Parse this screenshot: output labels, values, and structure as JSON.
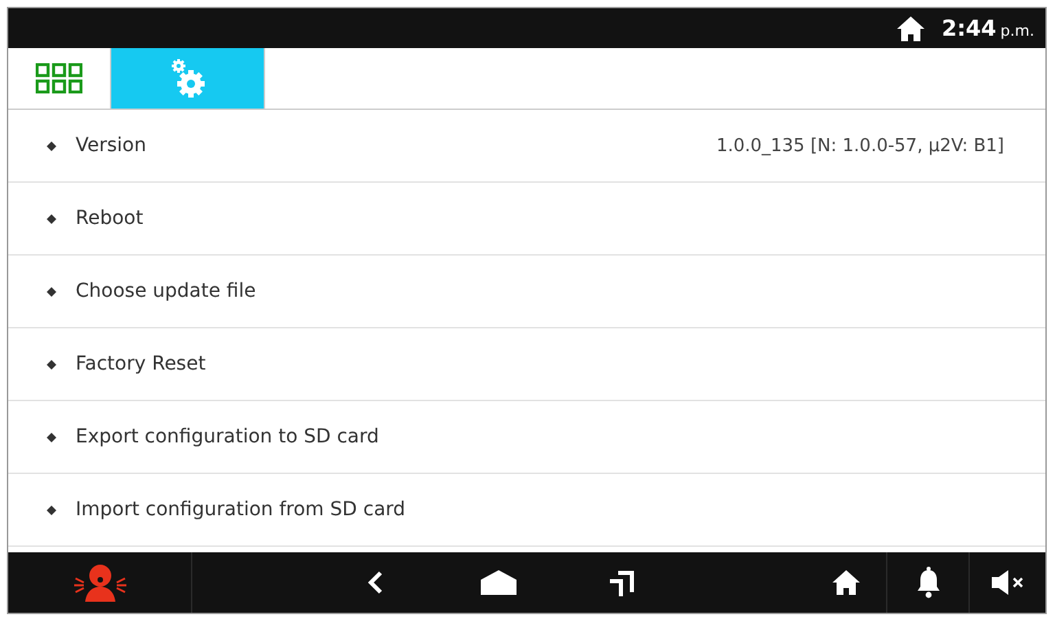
{
  "status_bar": {
    "time": "2:44",
    "period": "p.m."
  },
  "tabs": [
    {
      "kind": "apps",
      "selected": false
    },
    {
      "kind": "settings",
      "selected": true
    }
  ],
  "items": [
    {
      "label": "Version",
      "value": "1.0.0_135 [N: 1.0.0-57, µ2V: B1]"
    },
    {
      "label": "Reboot"
    },
    {
      "label": "Choose update file"
    },
    {
      "label": "Factory Reset"
    },
    {
      "label": "Export configuration to SD card"
    },
    {
      "label": "Import configuration from SD card"
    }
  ]
}
